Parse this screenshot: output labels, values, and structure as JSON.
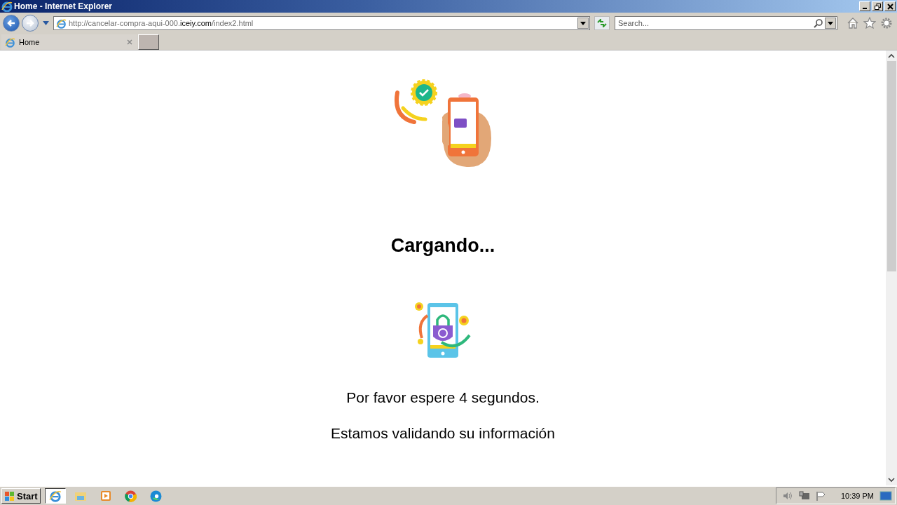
{
  "window": {
    "title": "Home - Internet Explorer"
  },
  "address_bar": {
    "url_prefix": "http://cancelar-compra-aqui-000.",
    "url_domain": "iceiy.com",
    "url_suffix": "/index2.html"
  },
  "search": {
    "placeholder": "Search..."
  },
  "tabs": [
    {
      "label": "Home",
      "selected": true
    }
  ],
  "page": {
    "heading": "Cargando...",
    "message": "Por favor espere 4 segundos.",
    "note": "Estamos validando su información"
  },
  "taskbar": {
    "start": "Start",
    "apps": [
      {
        "kind": "ie",
        "selected": true
      },
      {
        "kind": "explorer",
        "selected": false
      },
      {
        "kind": "media",
        "selected": false
      },
      {
        "kind": "chrome",
        "selected": false
      },
      {
        "kind": "edge",
        "selected": false
      }
    ],
    "clock": "10:39 PM"
  }
}
